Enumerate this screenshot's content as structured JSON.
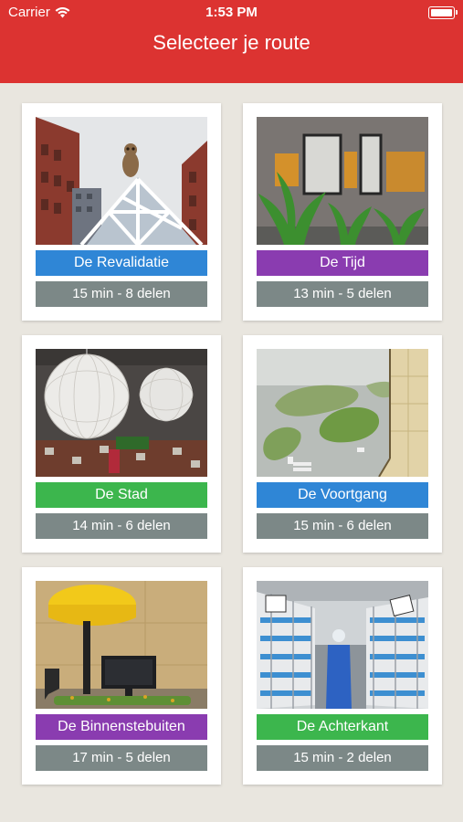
{
  "status_bar": {
    "carrier": "Carrier",
    "time": "1:53 PM"
  },
  "header": {
    "title": "Selecteer je route"
  },
  "routes": [
    {
      "name": "De Revalidatie",
      "meta": "15 min - 8 delen",
      "color": "#2f86d6",
      "photo": "building-with-owl-statue-icon"
    },
    {
      "name": "De Tijd",
      "meta": "13 min - 5 delen",
      "color": "#8a3cb0",
      "photo": "window-with-plants-icon"
    },
    {
      "name": "De Stad",
      "meta": "14 min - 6 delen",
      "color": "#3cb64d",
      "photo": "hanging-sphere-lamps-icon"
    },
    {
      "name": "De Voortgang",
      "meta": "15 min - 6 delen",
      "color": "#2f86d6",
      "photo": "aerial-roundabout-view-icon"
    },
    {
      "name": "De Binnenstebuiten",
      "meta": "17 min - 5 delen",
      "color": "#8a3cb0",
      "photo": "yellow-lamp-desk-icon"
    },
    {
      "name": "De Achterkant",
      "meta": "15 min - 2 delen",
      "color": "#3cb64d",
      "photo": "storage-racks-worker-icon"
    }
  ],
  "colors": {
    "header": "#dc3331",
    "meta_bg": "#7c8887",
    "background": "#e9e6df"
  }
}
